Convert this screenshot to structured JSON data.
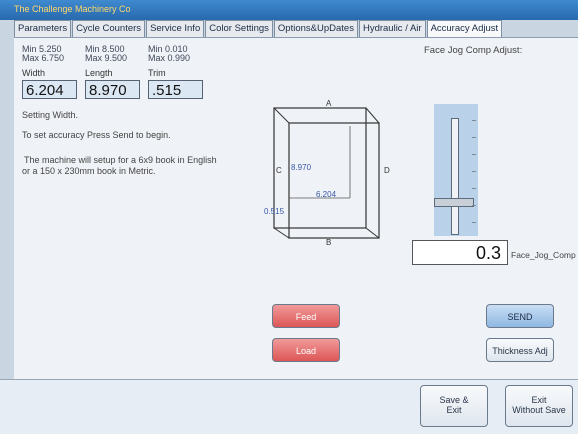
{
  "app": {
    "title": "The Challenge Machinery Co"
  },
  "tabs": [
    "Parameters",
    "Cycle Counters",
    "Service Info",
    "Color Settings",
    "Options&UpDates",
    "Hydraulic / Air",
    "Accuracy Adjust"
  ],
  "fields": {
    "width": {
      "label": "Width",
      "min": "Min 5.250",
      "max": "Max 6.750",
      "value": "6.204"
    },
    "length": {
      "label": "Length",
      "min": "Min 8.500",
      "max": "Max 9.500",
      "value": "8.970"
    },
    "trim": {
      "label": "Trim",
      "min": "Min 0.010",
      "max": "Max 0.990",
      "value": ".515"
    }
  },
  "status": {
    "setting": "Setting Width.",
    "instruction": "To set accuracy Press Send to begin.",
    "info_line1": "The machine will setup for a 6x9 book in English",
    "info_line2": "or a 150 x 230mm book in Metric."
  },
  "diagram": {
    "labels": {
      "a": "A",
      "b": "B",
      "c": "C",
      "d": "D"
    },
    "values": {
      "length": "8.970",
      "width": "6.204",
      "trim": "0.515"
    }
  },
  "face_jog": {
    "title": "Face Jog Comp Adjust:",
    "value": "0.3",
    "label": "Face_Jog_Comp",
    "slider_position": 0.3
  },
  "buttons": {
    "feed": "Feed",
    "load": "Load",
    "send": "SEND",
    "thickness": "Thickness Adj",
    "save_exit": [
      "Save &",
      "Exit"
    ],
    "exit_no_save": [
      "Exit",
      "Without Save"
    ]
  }
}
